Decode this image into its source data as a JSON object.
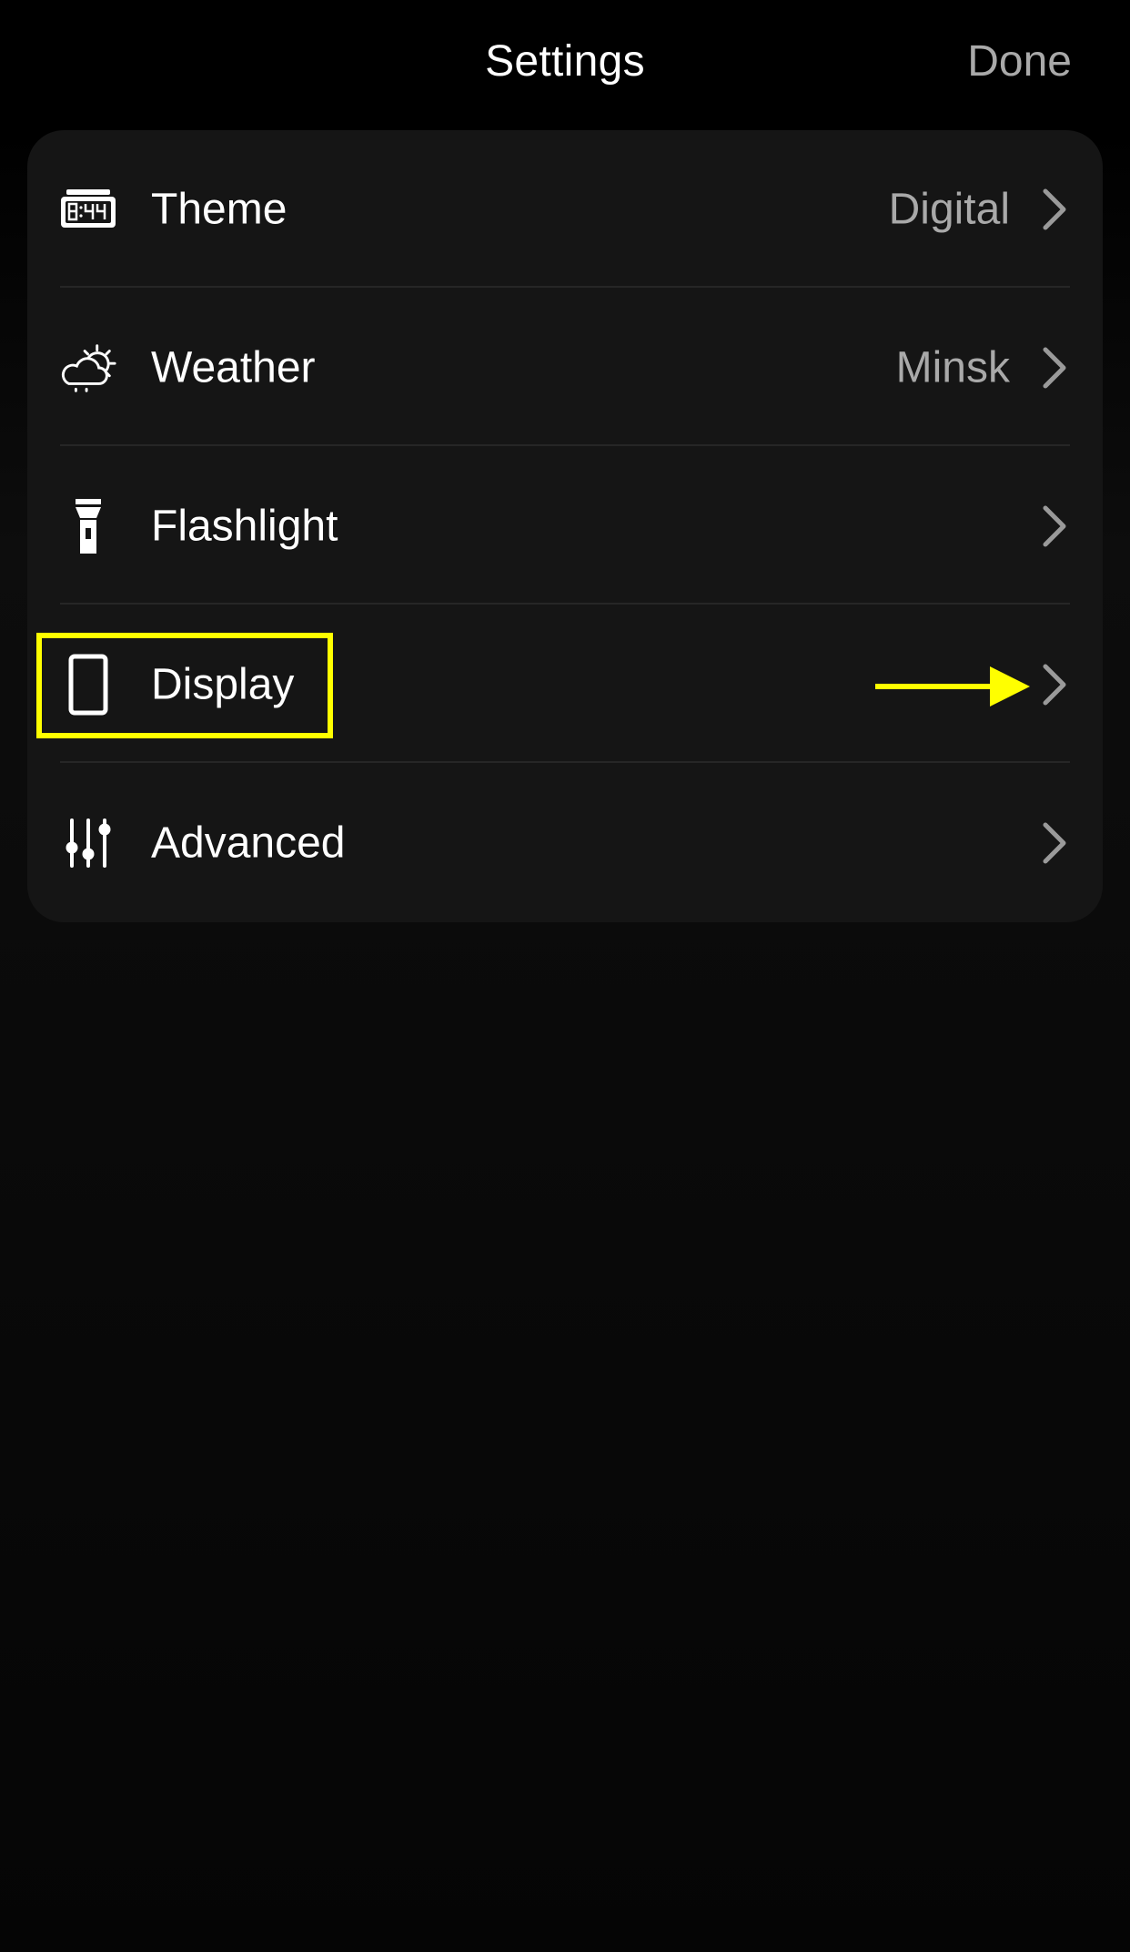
{
  "header": {
    "title": "Settings",
    "done_label": "Done"
  },
  "settings": {
    "items": [
      {
        "label": "Theme",
        "value": "Digital",
        "icon": "digital-clock-icon"
      },
      {
        "label": "Weather",
        "value": "Minsk",
        "icon": "cloud-sun-icon"
      },
      {
        "label": "Flashlight",
        "value": "",
        "icon": "flashlight-icon"
      },
      {
        "label": "Display",
        "value": "",
        "icon": "phone-display-icon"
      },
      {
        "label": "Advanced",
        "value": "",
        "icon": "sliders-icon"
      }
    ]
  },
  "annotation": {
    "highlight_color": "#ffff00",
    "highlighted_item": "Display"
  },
  "colors": {
    "background": "#000000",
    "card": "#151515",
    "separator": "#262626",
    "secondary_text": "#a9a9a9",
    "primary_text": "#ffffff"
  }
}
